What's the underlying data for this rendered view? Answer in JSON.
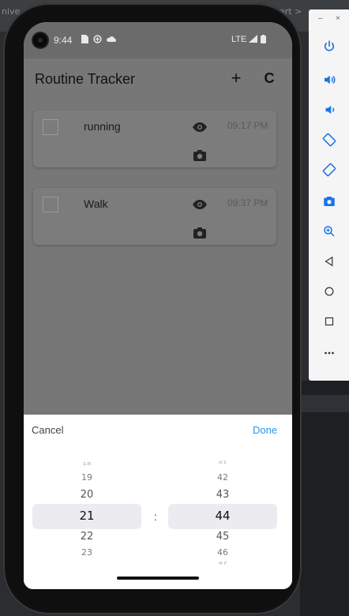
{
  "background": {
    "tab_left": "nive",
    "tab_right": "art >"
  },
  "emulator_toolbar": {
    "minimize": "–",
    "close": "×",
    "buttons": [
      "power-icon",
      "volume-up-icon",
      "volume-down-icon",
      "rotate-left-icon",
      "rotate-right-icon",
      "screenshot-icon",
      "zoom-icon",
      "back-icon",
      "home-icon",
      "overview-icon",
      "more-icon"
    ]
  },
  "status_bar": {
    "time": "9:44",
    "network": "LTE"
  },
  "app": {
    "title": "Routine Tracker",
    "add_label": "+",
    "refresh_label": "C",
    "tasks": [
      {
        "name": "running",
        "time": "09:17 PM"
      },
      {
        "name": "Walk",
        "time": "09:37 PM"
      }
    ]
  },
  "time_picker": {
    "cancel_label": "Cancel",
    "done_label": "Done",
    "separator": ":",
    "hours": [
      "18",
      "19",
      "20",
      "21",
      "22",
      "23"
    ],
    "minutes": [
      "41",
      "42",
      "43",
      "44",
      "45",
      "46",
      "47"
    ],
    "selected_hour": "21",
    "selected_minute": "44"
  },
  "colors": {
    "accent": "#2196f3",
    "overlay": "#777777",
    "phone_frame": "#0f0f10"
  }
}
